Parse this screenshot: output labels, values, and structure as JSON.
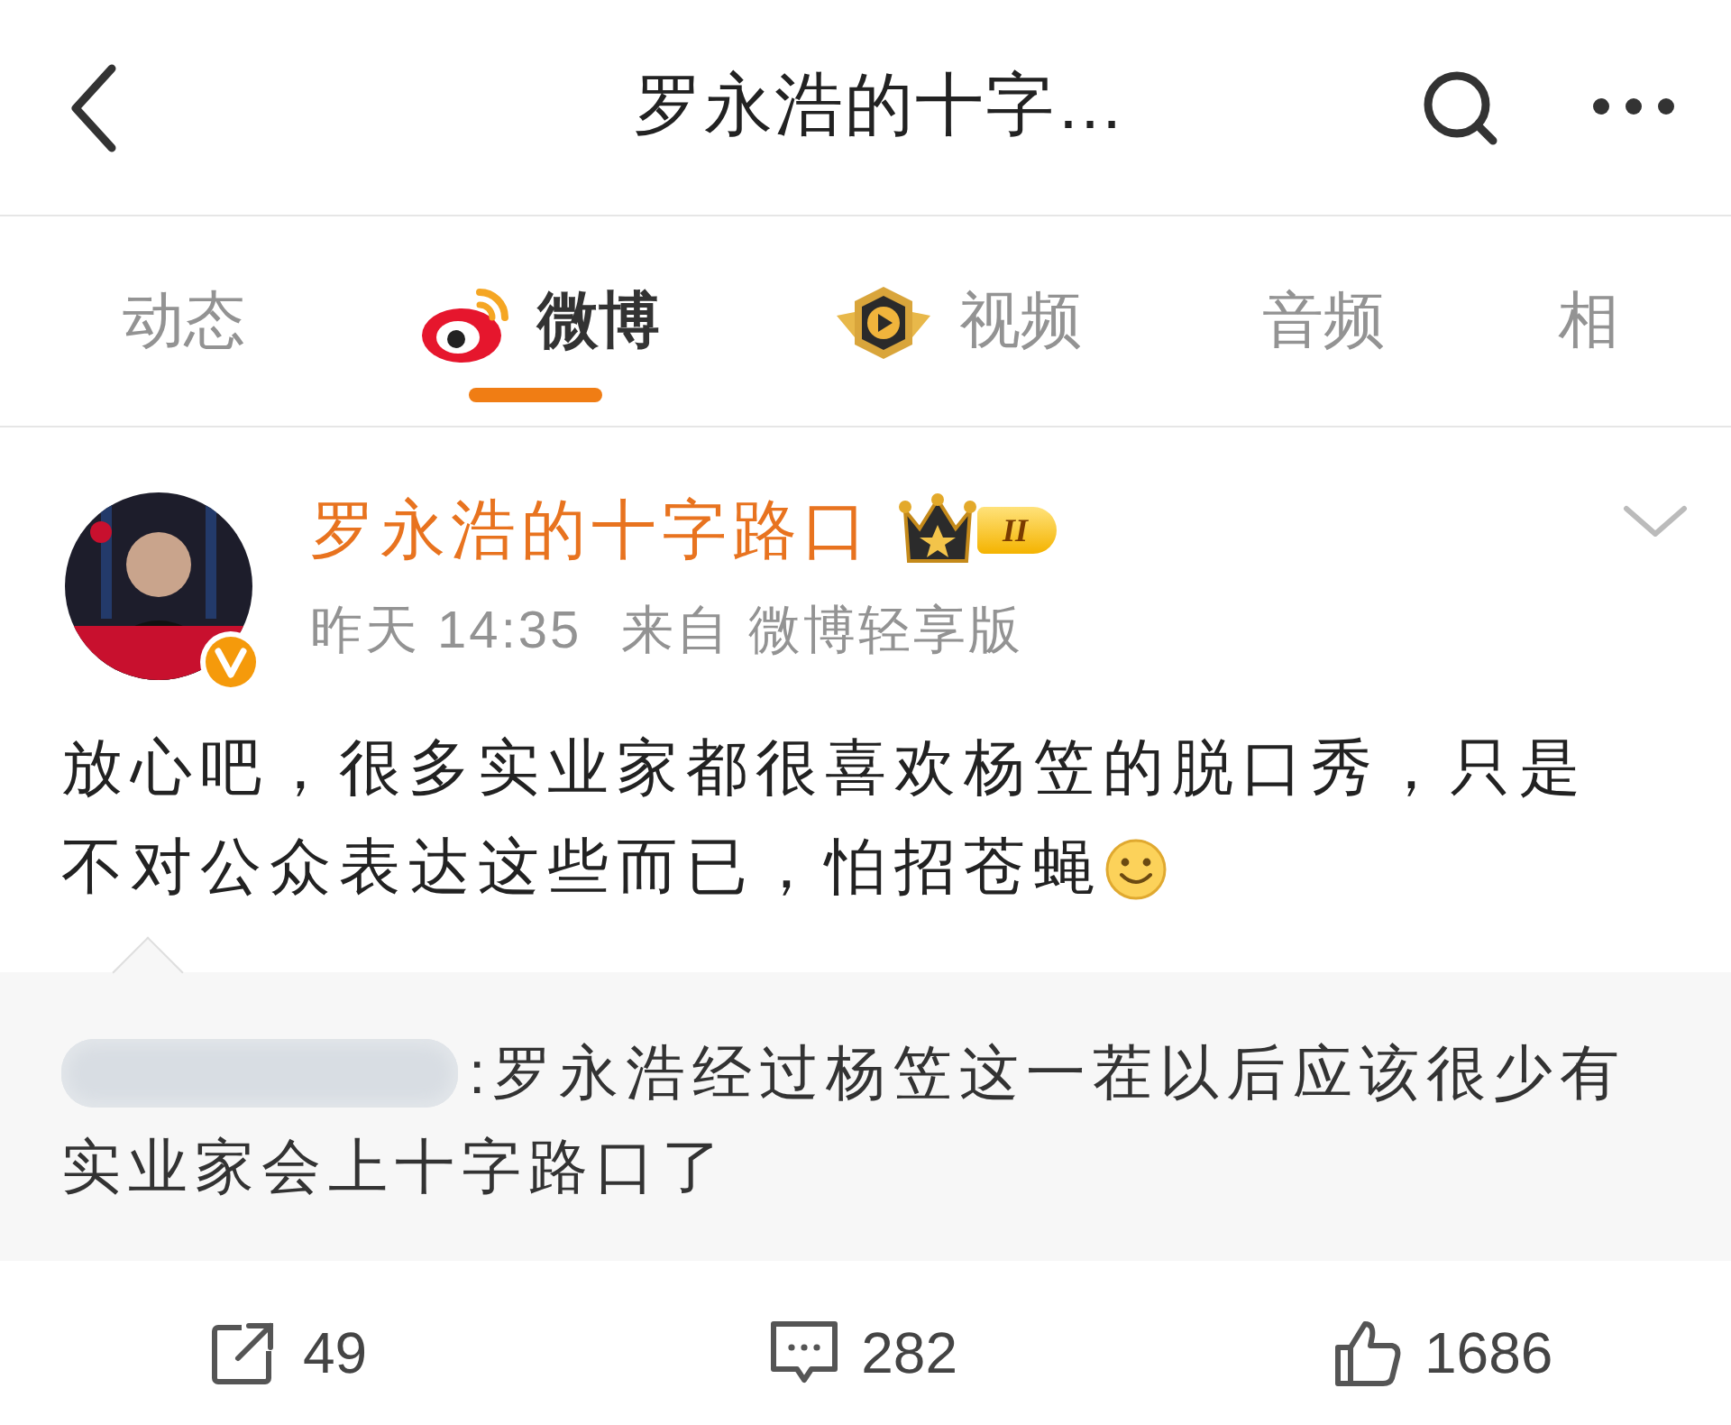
{
  "header": {
    "title": "罗永浩的十字…"
  },
  "tabs": [
    {
      "label": "动态",
      "selected": false,
      "kind": "plain"
    },
    {
      "label": "微博",
      "selected": true,
      "kind": "weibo"
    },
    {
      "label": "视频",
      "selected": false,
      "kind": "video"
    },
    {
      "label": "音频",
      "selected": false,
      "kind": "plain"
    },
    {
      "label": "相",
      "selected": false,
      "kind": "plain"
    }
  ],
  "post": {
    "author": "罗永浩的十字路口",
    "member_level": "II",
    "verified": true,
    "time": "昨天 14:35",
    "source": "来自 微博轻享版",
    "text_lines": [
      "放心吧，很多实业家都很喜欢杨笠的脱口秀，只是",
      "不对公众表达这些而已，怕招苍蝇"
    ]
  },
  "repost": {
    "text_lines": [
      ":罗永浩经过杨笠这一茬以后应该很少有",
      "实业家会上十字路口了"
    ]
  },
  "actions": [
    {
      "kind": "share",
      "count": "49"
    },
    {
      "kind": "comment",
      "count": "282"
    },
    {
      "kind": "like",
      "count": "1686"
    }
  ]
}
